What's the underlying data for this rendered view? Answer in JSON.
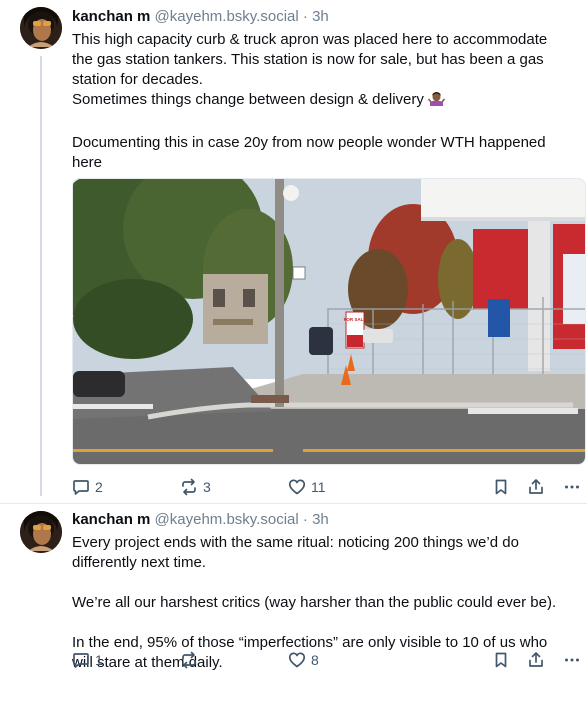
{
  "posts": [
    {
      "author": {
        "name": "kanchan m",
        "handle": "@kayehm.bsky.social"
      },
      "separator": "·",
      "time": "3h",
      "lines": [
        "This high capacity curb & truck apron was placed here to accommodate",
        "the gas station tankers. This station is now for sale, but has been a gas",
        "station for decades.",
        "Sometimes things change between design & delivery",
        "",
        "Documenting this in case 20y from now people wonder WTH happened",
        "here"
      ],
      "photo_sign": "FOR SALE",
      "stats": {
        "replies": "2",
        "reposts": "3",
        "likes": "11"
      },
      "icons": [
        "reply-icon",
        "repost-icon",
        "like-icon",
        "bookmark-icon",
        "share-icon",
        "more-icon"
      ]
    },
    {
      "author": {
        "name": "kanchan m",
        "handle": "@kayehm.bsky.social"
      },
      "separator": "·",
      "time": "3h",
      "lines": [
        "Every project ends with the same ritual: noticing 200 things we’d do",
        "differently next time.",
        "",
        "We’re all our harshest critics (way harsher than the public could ever be).",
        "",
        "In the end, 95% of those “imperfections” are only visible to 10 of us who",
        "will stare at them daily."
      ],
      "stats": {
        "replies": "1",
        "reposts": "",
        "likes": "8"
      },
      "icons": [
        "reply-icon",
        "repost-icon",
        "like-icon",
        "bookmark-icon",
        "share-icon",
        "more-icon"
      ]
    }
  ],
  "colors": {
    "text": "#0b0f14",
    "muted": "#6f7f8f",
    "action": "#42576c",
    "divider": "#e6eaee",
    "thread_line": "#d4dbe2"
  }
}
